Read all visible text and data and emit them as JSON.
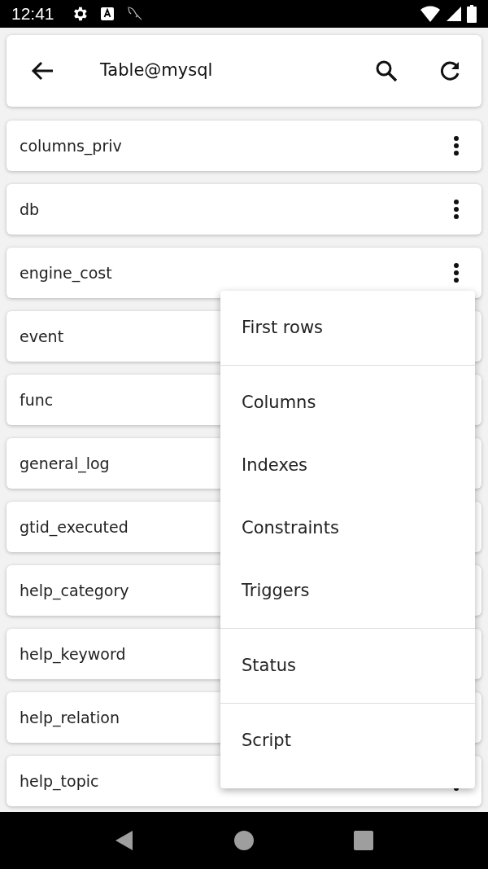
{
  "status_bar": {
    "time": "12:41"
  },
  "toolbar": {
    "title": "Table@mysql"
  },
  "tables": [
    {
      "name": "columns_priv",
      "menu_open": false
    },
    {
      "name": "db",
      "menu_open": false
    },
    {
      "name": "engine_cost",
      "menu_open": true
    },
    {
      "name": "event",
      "menu_open": false
    },
    {
      "name": "func",
      "menu_open": false
    },
    {
      "name": "general_log",
      "menu_open": false
    },
    {
      "name": "gtid_executed",
      "menu_open": false
    },
    {
      "name": "help_category",
      "menu_open": false
    },
    {
      "name": "help_keyword",
      "menu_open": false
    },
    {
      "name": "help_relation",
      "menu_open": false
    },
    {
      "name": "help_topic",
      "menu_open": false
    }
  ],
  "menu": {
    "sections": [
      [
        "First rows"
      ],
      [
        "Columns",
        "Indexes",
        "Constraints",
        "Triggers"
      ],
      [
        "Status"
      ],
      [
        "Script"
      ]
    ]
  }
}
